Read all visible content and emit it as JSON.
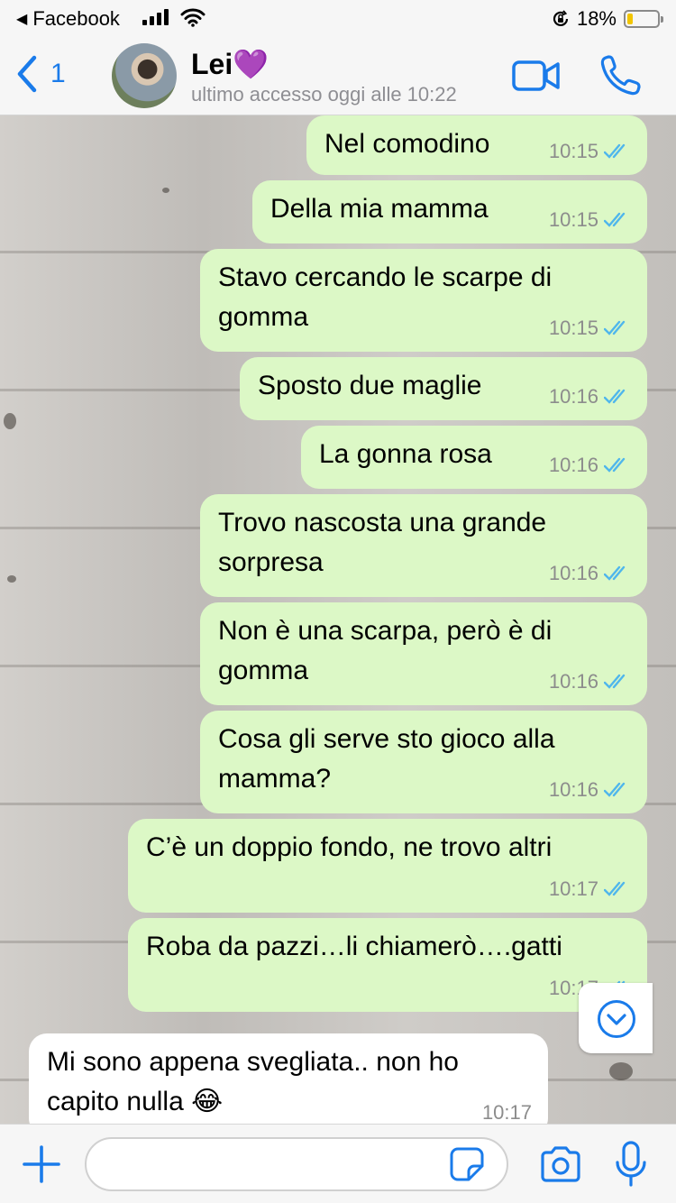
{
  "status_bar": {
    "back_app": "Facebook",
    "battery_percent": "18%",
    "battery_level": 0.18
  },
  "header": {
    "back_count": "1",
    "contact_name": "Lei💜",
    "last_seen": "ultimo accesso oggi alle 10:22"
  },
  "messages": [
    {
      "text": "Nel comodino",
      "time": "10:15"
    },
    {
      "text": "Della mia mamma",
      "time": "10:15"
    },
    {
      "text": "Stavo cercando le scarpe di gomma",
      "time": "10:15"
    },
    {
      "text": "Sposto due maglie",
      "time": "10:16"
    },
    {
      "text": "La gonna rosa",
      "time": "10:16"
    },
    {
      "text": "Trovo nascosta una grande sorpresa",
      "time": "10:16"
    },
    {
      "text": "Non è una scarpa, però è di gomma",
      "time": "10:16"
    },
    {
      "text": "Cosa gli serve sto gioco alla mamma?",
      "time": "10:16"
    },
    {
      "text": "C’è un doppio fondo, ne trovo altri",
      "time": "10:17"
    },
    {
      "text": "Roba da pazzi…li chiamerò….gatti",
      "time": "10:17"
    },
    {
      "text": "Mi sono appena svegliata.. non ho capito nulla 😂",
      "time": "10:17"
    }
  ],
  "input": {
    "placeholder": ""
  },
  "colors": {
    "accent": "#1a7bea",
    "outgoing_bubble": "#dcf8c6",
    "incoming_bubble": "#ffffff",
    "read_ticks": "#4fb6ec"
  }
}
